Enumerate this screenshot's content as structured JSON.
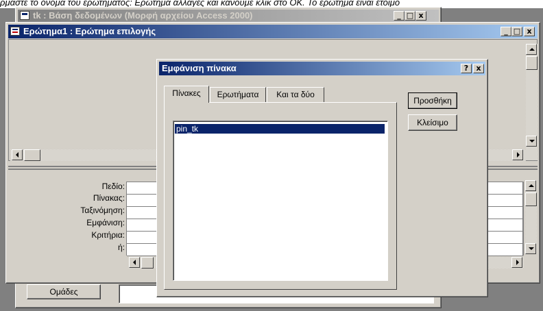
{
  "top_caption": "ρμάστε το όνομα του ερωτήματος: Ερώτημα αλλαγές και κάνουμε κλικ στο ΟΚ. Το ερώτημα είναι έτοιμο",
  "db_window": {
    "title": "tk : Βάση δεδομένων (Μορφή αρχείου Access 2000)",
    "groups_button": "Ομάδες"
  },
  "query_window": {
    "title": "Ερώτημα1 : Ερώτημα επιλογής",
    "grid_row_labels": [
      "Πεδίο:",
      "Πίνακας:",
      "Ταξινόμηση:",
      "Εμφάνιση:",
      "Κριτήρια:",
      "ή:"
    ]
  },
  "dialog": {
    "title": "Εμφάνιση πίνακα",
    "help_glyph": "?",
    "close_glyph": "x",
    "tabs": [
      "Πίνακες",
      "Ερωτήματα",
      "Και τα δύο"
    ],
    "active_tab": "Πίνακες",
    "list_items": [
      "pin_tk"
    ],
    "selected_item": "pin_tk",
    "add_button": "Προσθήκη",
    "close_button": "Κλείσιμο"
  },
  "colors": {
    "active_title_start": "#0a246a",
    "active_title_end": "#a6caf0",
    "inactive_title_start": "#808080",
    "inactive_title_end": "#c0c0c0",
    "face": "#d4d0c8",
    "workspace": "#808080"
  }
}
